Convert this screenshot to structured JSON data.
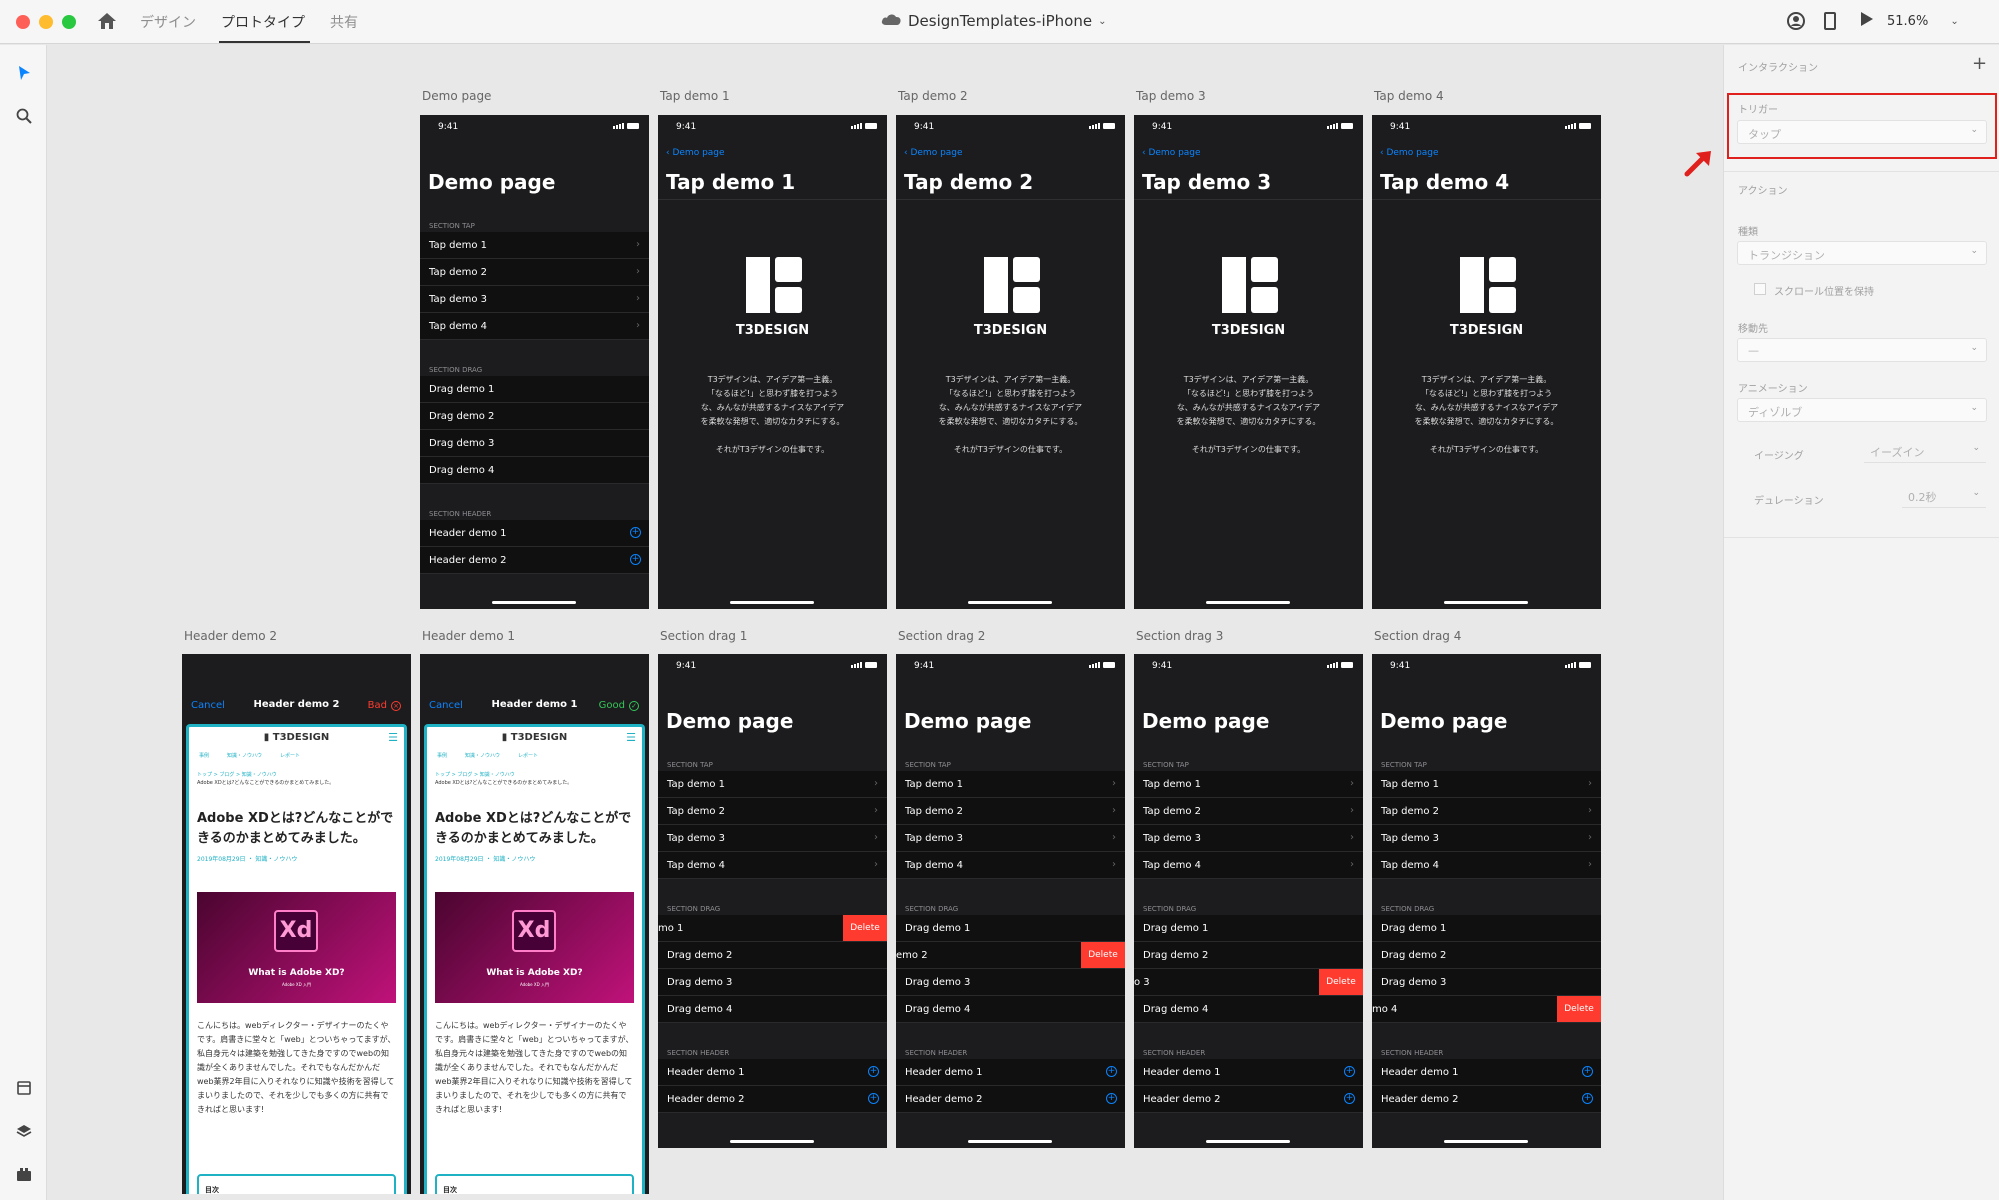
{
  "app": {
    "tabs": [
      "デザイン",
      "プロトタイプ",
      "共有"
    ],
    "active_tab": "プロトタイプ",
    "doc_title": "DesignTemplates-iPhone",
    "zoom": "51.6%"
  },
  "artboards": [
    {
      "label": "Demo page"
    },
    {
      "label": "Tap demo 1"
    },
    {
      "label": "Tap demo 2"
    },
    {
      "label": "Tap demo 3"
    },
    {
      "label": "Tap demo 4"
    },
    {
      "label": "Header demo 2"
    },
    {
      "label": "Header demo 1"
    },
    {
      "label": "Section drag 1"
    },
    {
      "label": "Section drag 2"
    },
    {
      "label": "Section drag 3"
    },
    {
      "label": "Section drag 4"
    }
  ],
  "phone": {
    "time": "9:41",
    "demo_title": "Demo page",
    "back": "Demo page",
    "section_tap": "SECTION TAP",
    "section_drag": "SECTION DRAG",
    "section_header": "SECTION HEADER",
    "tap_items": [
      "Tap demo 1",
      "Tap demo 2",
      "Tap demo 3",
      "Tap demo 4"
    ],
    "drag_items": [
      "Drag demo 1",
      "Drag demo 2",
      "Drag demo 3",
      "Drag demo 4"
    ],
    "header_items": [
      "Header demo 1",
      "Header demo 2"
    ],
    "delete": "Delete",
    "tap_titles": [
      "Tap demo 1",
      "Tap demo 2",
      "Tap demo 3",
      "Tap demo 4"
    ],
    "brand": "T3DESIGN",
    "desc_lines": [
      "T3デザインは、アイデア第一主義。",
      "「なるほど!」と思わず膝を打つよう",
      "な、みんなが共感するナイスなアイデア",
      "を柔軟な発想で、適切なカタチにする。",
      "",
      "それがT3デザインの仕事です。"
    ],
    "drag_partial": [
      "mo 1",
      "emo 2",
      "o 3",
      "mo 4"
    ]
  },
  "headers": [
    {
      "cancel": "Cancel",
      "title": "Header demo 2",
      "status": "Bad",
      "status_color": "#ff3b30"
    },
    {
      "cancel": "Cancel",
      "title": "Header demo 1",
      "status": "Good",
      "status_color": "#34c759"
    }
  ],
  "article": {
    "brand": "T3DESIGN",
    "nav": [
      "事例",
      "知識・ノウハウ",
      "レポート"
    ],
    "breadcrumb": "トップ > ブログ > 知識・ノウハウ",
    "breadcrumb_sub": "Adobe XDとは?どんなことができるのかまとめてみました。",
    "heading": "Adobe XDとは?どんなことができるのかまとめてみました。",
    "date": "2019年08月29日 ・ 知識・ノウハウ",
    "hero_logo": "Xd",
    "hero_caption": "What is Adobe XD?",
    "hero_sub": "Adobe XD 入門",
    "body": "こんにちは。webディレクター・デザイナーのたくやです。肩書きに堂々と「web」とついちゃってますが、私自身元々は建築を勉強してきた身ですのでwebの知識が全くありませんでした。それでもなんだかんだweb業界2年目に入りそれなりに知識や技術を習得してまいりましたので、それを少しでも多くの方に共有できればと思います!",
    "toc": "目次"
  },
  "panel": {
    "interaction": "インタラクション",
    "trigger_label": "トリガー",
    "trigger_value": "タップ",
    "action": "アクション",
    "type_label": "種類",
    "type_value": "トランジション",
    "scroll_keep": "スクロール位置を保持",
    "dest_label": "移動先",
    "dest_value": "—",
    "anim_label": "アニメーション",
    "anim_value": "ディゾルブ",
    "easing_label": "イージング",
    "easing_value": "イーズイン",
    "duration_label": "デュレーション",
    "duration_value": "0.2秒"
  },
  "colors": {
    "accent": "#0a84ff",
    "delete": "#ff3b30",
    "highlight": "#e0201c",
    "header_border": "#1fb2c5"
  }
}
